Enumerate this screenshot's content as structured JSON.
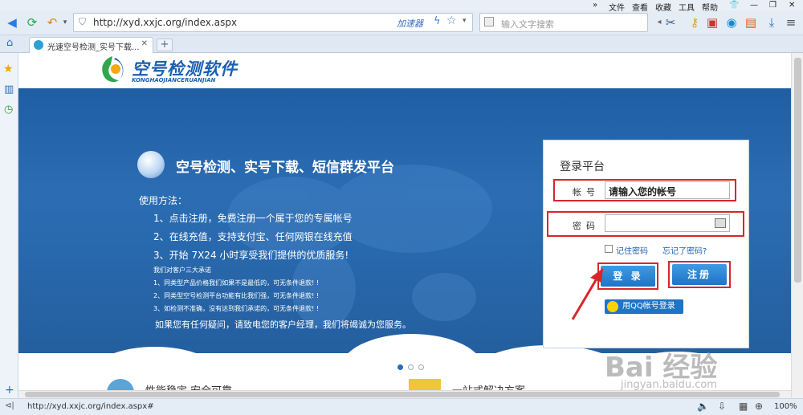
{
  "menu": {
    "items": [
      "文件",
      "查看",
      "收藏",
      "工具",
      "帮助"
    ]
  },
  "toolbar": {
    "url": "http://xyd.xxjc.org/index.aspx",
    "accelerator": "加速器",
    "search_placeholder": "输入文字搜索"
  },
  "tab": {
    "title": "光速空号检测_实号下载..."
  },
  "page": {
    "logo_title": "空号检测软件",
    "logo_subtitle": "KONGHAOJIANCERUANJIAN",
    "headline": "空号检测、实号下载、短信群发平台",
    "usage_title": "使用方法：",
    "usage_steps": [
      "1、点击注册，免费注册一个属于您的专属帐号",
      "2、在线充值，支持支付宝、任何网银在线充值",
      "3、开始 7X24 小时享受我们提供的优质服务!"
    ],
    "promise_title": "我们对客户三大承诺",
    "promises": [
      "1、同类型产品价格我们如果不是最低的，可无条件退款! !",
      "2、同类型空号检测平台功能有比我们强，可无条件退款! !",
      "3、如检测不准确，没有达到我们承诺的，可无条件退款! !"
    ],
    "contact": "如果您有任何疑问，请致电您的客户经理，我们将竭诚为您服务。",
    "bottom_left": "性能稳定  安全可靠",
    "bottom_right": "一站式解决方案"
  },
  "login": {
    "title": "登录平台",
    "account_label": "帐号",
    "account_value": "请输入您的帐号",
    "password_label": "密码",
    "remember": "记住密码",
    "forgot": "忘记了密码?",
    "login_button": "登 录",
    "register_button": "注册",
    "qq_login": "用QQ帐号登录"
  },
  "status": {
    "url": "http://xyd.xxjc.org/index.aspx#",
    "zoom": "100%"
  },
  "watermark": {
    "text": "Bai 经验",
    "sub": "jingyan.baidu.com"
  },
  "colors": {
    "banner": "#2b6db3",
    "highlight": "#d9262b",
    "button": "#1f73c6"
  }
}
